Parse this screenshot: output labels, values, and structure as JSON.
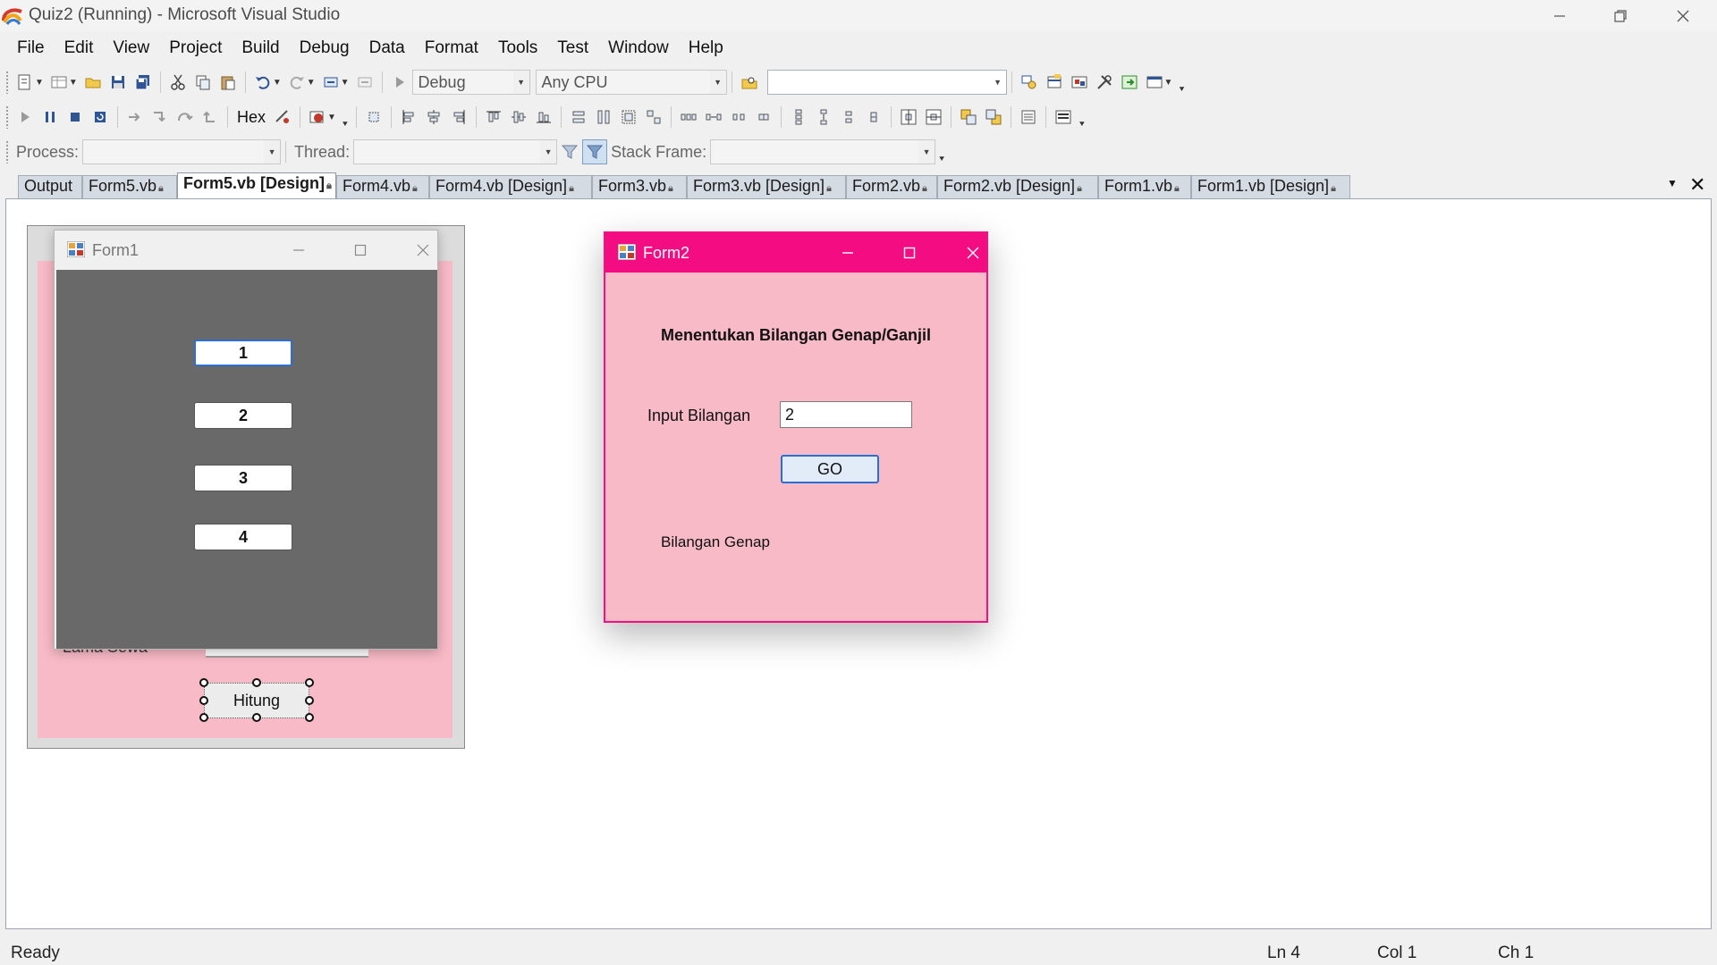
{
  "window": {
    "title": "Quiz2 (Running) - Microsoft Visual Studio",
    "controls": {
      "minimize": "—",
      "maximize": "❐",
      "close": "✕"
    }
  },
  "menu": [
    "File",
    "Edit",
    "View",
    "Project",
    "Build",
    "Debug",
    "Data",
    "Format",
    "Tools",
    "Test",
    "Window",
    "Help"
  ],
  "toolbar": {
    "config_combo": "Debug",
    "platform_combo": "Any CPU",
    "find_combo": "",
    "hex_label": "Hex",
    "process_label": "Process:",
    "process_value": "",
    "thread_label": "Thread:",
    "thread_value": "",
    "stack_frame_label": "Stack Frame:",
    "stack_frame_value": ""
  },
  "tabs": [
    {
      "label": "Output",
      "locked": false,
      "active": false
    },
    {
      "label": "Form5.vb",
      "locked": true,
      "active": false
    },
    {
      "label": "Form5.vb [Design]",
      "locked": true,
      "active": true
    },
    {
      "label": "Form4.vb",
      "locked": true,
      "active": false
    },
    {
      "label": "Form4.vb [Design]",
      "locked": true,
      "active": false
    },
    {
      "label": "Form3.vb",
      "locked": true,
      "active": false
    },
    {
      "label": "Form3.vb [Design]",
      "locked": true,
      "active": false
    },
    {
      "label": "Form2.vb",
      "locked": true,
      "active": false
    },
    {
      "label": "Form2.vb [Design]",
      "locked": true,
      "active": false
    },
    {
      "label": "Form1.vb",
      "locked": true,
      "active": false
    },
    {
      "label": "Form1.vb [Design]",
      "locked": true,
      "active": false
    }
  ],
  "designer": {
    "hidden_label": "Lama Sewa",
    "hitung_button": "Hitung"
  },
  "form1": {
    "title": "Form1",
    "buttons": [
      "1",
      "2",
      "3",
      "4"
    ]
  },
  "form2": {
    "title": "Form2",
    "heading": "Menentukan Bilangan Genap/Ganjil",
    "input_label": "Input Bilangan",
    "input_value": "2",
    "go_button": "GO",
    "result": "Bilangan Genap"
  },
  "statusbar": {
    "ready": "Ready",
    "ln": "Ln 4",
    "col": "Col 1",
    "ch": "Ch 1"
  },
  "colors": {
    "form_pink": "#f8bac6",
    "form2_titlebar": "#f40d82",
    "form1_client": "#696969",
    "focus_blue": "#2b6fd6"
  }
}
